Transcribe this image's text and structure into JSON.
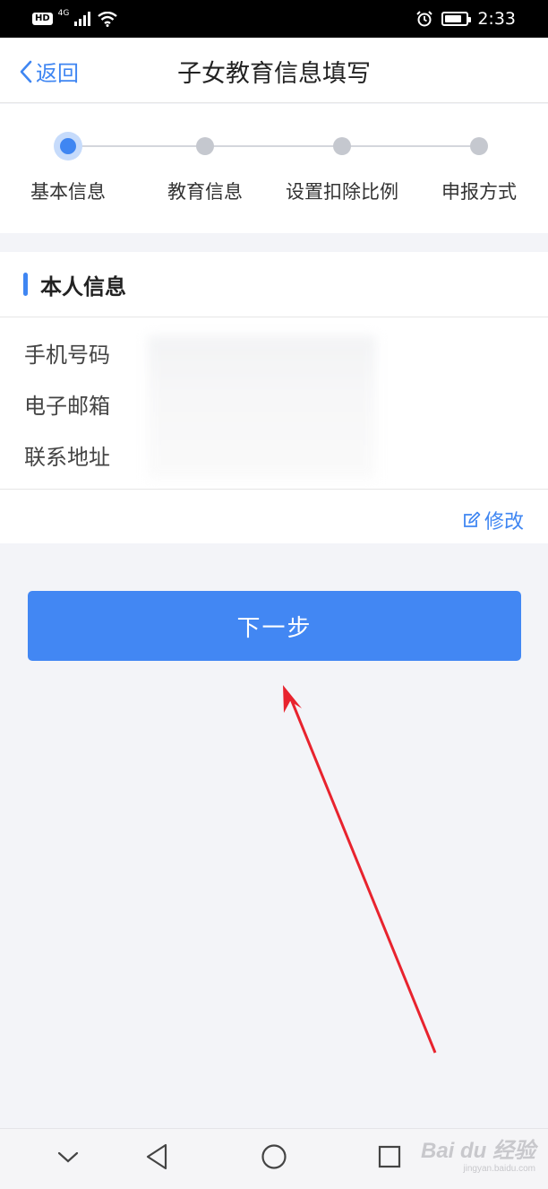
{
  "status_bar": {
    "hd": "HD",
    "network": "4G",
    "time": "2:33"
  },
  "header": {
    "back_label": "返回",
    "title": "子女教育信息填写"
  },
  "steps": [
    {
      "label": "基本信息",
      "active": true
    },
    {
      "label": "教育信息",
      "active": false
    },
    {
      "label": "设置扣除比例",
      "active": false
    },
    {
      "label": "申报方式",
      "active": false
    }
  ],
  "personal_info": {
    "title": "本人信息",
    "fields": [
      {
        "label": "手机号码"
      },
      {
        "label": "电子邮箱"
      },
      {
        "label": "联系地址"
      }
    ],
    "edit_label": "修改"
  },
  "next_button": "下一步",
  "watermark": {
    "main": "Bai du 经验",
    "sub": "jingyan.baidu.com"
  },
  "colors": {
    "accent": "#3f86f2",
    "button": "#4287f3",
    "arrow": "#e8232e"
  }
}
